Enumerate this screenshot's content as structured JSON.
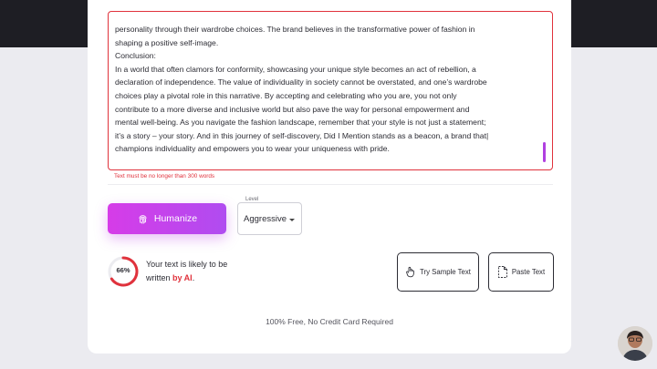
{
  "editor": {
    "text": "personality through their wardrobe choices. The brand believes in the transformative power of fashion in\nshaping a positive self-image.\nConclusion:\nIn a world that often clamors for conformity, showcasing your unique style becomes an act of rebellion, a\ndeclaration of independence. The value of individuality in society cannot be overstated, and one’s wardrobe\nchoices play a pivotal role in this narrative. By accepting and celebrating who you are, you not only\ncontribute to a more diverse and inclusive world but also pave the way for personal empowerment and\nmental well-being. As you navigate the fashion landscape, remember that your style is not just a statement;\nit’s a story – your story. And in this journey of self-discovery, Did I Mention stands as a beacon, a brand that|\nchampions individuality and empowers you to wear your uniqueness with pride.",
    "error": "Text must be no longer than 300 words"
  },
  "actions": {
    "humanize_label": "Humanize",
    "level_label": "Level",
    "level_value": "Aggressive",
    "try_sample_label": "Try Sample Text",
    "paste_label": "Paste Text"
  },
  "result": {
    "percent": 66,
    "percent_label": "66%",
    "line1": "Your text is likely to be",
    "line2_prefix": "written ",
    "line2_highlight": "by AI",
    "line2_suffix": "."
  },
  "footer": {
    "note": "100% Free, No Credit Card Required"
  },
  "colors": {
    "accent": "#c846ec",
    "error": "#e0323c"
  },
  "icons": {
    "humanize": "fingerprint-icon",
    "try_sample": "hand-pointer-icon",
    "paste": "paste-document-icon",
    "level_dropdown": "chevron-down-icon"
  }
}
